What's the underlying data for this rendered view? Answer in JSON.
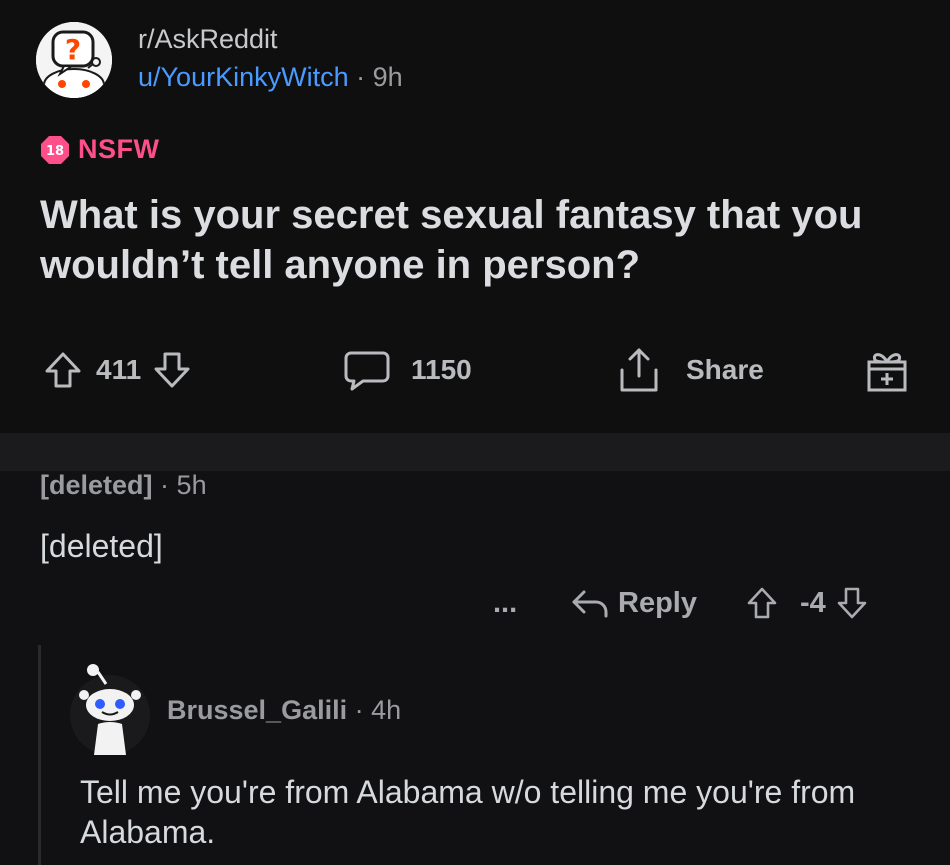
{
  "post": {
    "subreddit": "r/AskReddit",
    "author": "u/YourKinkyWitch",
    "separator": "·",
    "time": "9h",
    "nsfw_badge": "18",
    "nsfw_label": "NSFW",
    "title": "What is your secret sexual fantasy that you wouldn’t tell anyone in person?",
    "upvotes": "411",
    "comments": "1150",
    "share_label": "Share"
  },
  "comment": {
    "author": "[deleted]",
    "separator": "·",
    "time": "5h",
    "body": "[deleted]",
    "more_label": "...",
    "reply_label": "Reply",
    "score": "-4"
  },
  "reply": {
    "author": "Brussel_Galili",
    "separator": "·",
    "time": "4h",
    "body": "Tell me you're from Alabama w/o telling me you're from Alabama."
  },
  "colors": {
    "background": "#111113",
    "username_link": "#4a9bff",
    "nsfw": "#ff4f8a"
  }
}
